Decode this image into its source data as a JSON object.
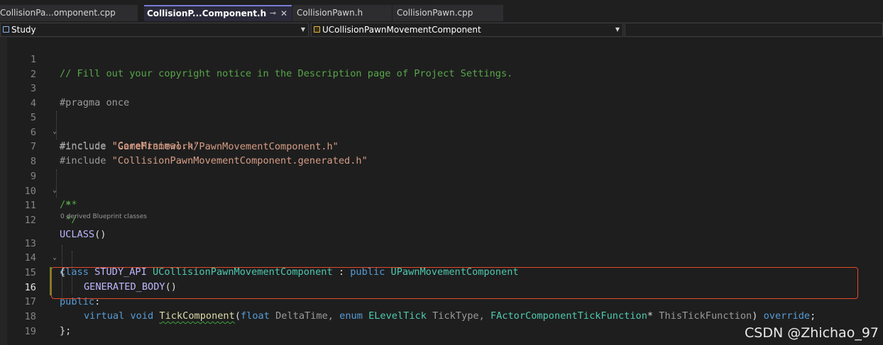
{
  "tabs": [
    {
      "label": "CollisionPa...omponent.cpp"
    },
    {
      "label": "CollisionP...Component.h",
      "pin": "⊸",
      "close": "✕"
    },
    {
      "label": "CollisionPawn.h"
    },
    {
      "label": "CollisionPawn.cpp"
    }
  ],
  "nav": {
    "project": "Study",
    "scope": "UCollisionPawnMovementComponent"
  },
  "editor": {
    "line_numbers": [
      "1",
      "2",
      "3",
      "4",
      "5",
      "6",
      "7",
      "8",
      "9",
      "10",
      "11",
      "12",
      "13",
      "14",
      "15",
      "16",
      "17",
      "18",
      "19"
    ],
    "current_line": "16",
    "code": {
      "l1": "// Fill out your copyright notice in the Description page of Project Settings.",
      "l3": "#pragma once",
      "l5_pp": "#include ",
      "l5_str": "\"CoreMinimal.h\"",
      "l6_pp": "#include ",
      "l6_str": "\"GameFramework/PawnMovementComponent.h\"",
      "l7_pp": "#include ",
      "l7_str": "\"CollisionPawnMovementComponent.generated.h\"",
      "l9": "/**",
      "l10": " *",
      "l11": " */",
      "l12_mac": "UCLASS",
      "l12_par": "()",
      "codelens": "0 derived Blueprint classes",
      "l13_kw1": "class ",
      "l13_mac": "STUDY_API ",
      "l13_typ1": "UCollisionPawnMovementComponent",
      "l13_colon": " : ",
      "l13_kw2": "public ",
      "l13_typ2": "UPawnMovementComponent",
      "l14": "{",
      "l15_mac": "GENERATED_BODY",
      "l15_par": "()",
      "l16_kw": "public",
      "l16_colon": ":",
      "l17_kw1": "virtual ",
      "l17_kw2": "void ",
      "l17_fn": "TickComponent",
      "l17_p1": "(",
      "l17_kw3": "float ",
      "l17_a1": "DeltaTime, ",
      "l17_kw4": "enum ",
      "l17_typ1": "ELevelTick ",
      "l17_a2": "TickType, ",
      "l17_typ2": "FActorComponentTickFunction",
      "l17_star": "* ",
      "l17_a3": "ThisTickFunction",
      "l17_p2": ") ",
      "l17_kw5": "override",
      "l17_semi": ";",
      "l18": "};"
    }
  },
  "watermark": "CSDN @Zhichao_97",
  "colors": {
    "comment": "#57a64a",
    "string": "#d69d85",
    "keyword": "#569cd6",
    "type": "#4ec9b0",
    "macro": "#beb7ff",
    "function": "#dcdcaa",
    "highlight_box": "#e04a2a"
  }
}
